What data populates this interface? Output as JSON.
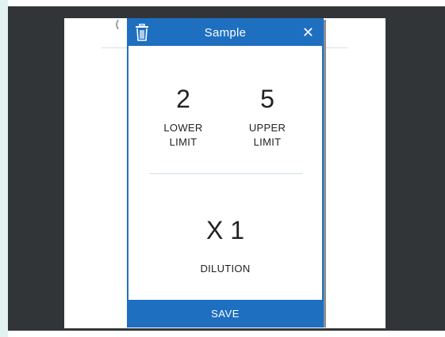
{
  "modal": {
    "title": "Sample",
    "close_symbol": "✕",
    "delete_icon": "trash-icon",
    "lower_limit": {
      "value": "2",
      "label": "LOWER\nLIMIT"
    },
    "upper_limit": {
      "value": "5",
      "label": "UPPER\nLIMIT"
    },
    "dilution": {
      "value": "X 1",
      "label": "DILUTION"
    },
    "save_label": "SAVE"
  },
  "colors": {
    "accent": "#1f6fc1",
    "backdrop": "#323538",
    "side_strip": "#e3f1f1"
  }
}
